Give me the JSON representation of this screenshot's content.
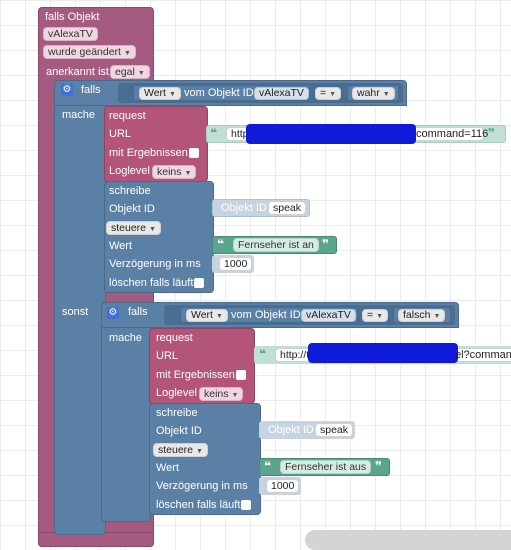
{
  "event_block": {
    "title": "falls Objekt",
    "object_id": "vAlexaTV",
    "trigger": "wurde geändert",
    "ack_label": "anerkannt ist",
    "ack_value": "egal"
  },
  "if_block_1": {
    "label": "falls",
    "do_label": "mache",
    "else_label": "sonst",
    "cond_value_select": "Wert",
    "cond_from_label": "vom Objekt ID",
    "cond_object_id": "vAlexaTV",
    "cond_operator": "=",
    "cond_compare": "wahr"
  },
  "request_1": {
    "title": "request",
    "url_label": "URL",
    "url_value_start": "http",
    "url_value_end": "command=116",
    "results_label": "mit Ergebnissen",
    "loglevel_label": "Loglevel",
    "loglevel_value": "keins"
  },
  "write_1": {
    "title": "schreibe",
    "object_label": "Objekt ID",
    "object_inline_label": "Objekt ID",
    "object_value": "speak",
    "mode": "steuere",
    "value_label": "Wert",
    "value_text": "Fernseher ist an",
    "delay_label": "Verzögerung in ms",
    "delay_value": "1000",
    "clear_label": "löschen falls läuft"
  },
  "if_block_2": {
    "label": "falls",
    "do_label": "mache",
    "cond_value_select": "Wert",
    "cond_from_label": "vom Objekt ID",
    "cond_object_id": "vAlexaTV",
    "cond_operator": "=",
    "cond_compare": "falsch"
  },
  "request_2": {
    "title": "request",
    "url_label": "URL",
    "url_value_start": "http://t",
    "url_value_end": "el?command",
    "results_label": "mit Ergebnissen",
    "loglevel_label": "Loglevel",
    "loglevel_value": "keins"
  },
  "write_2": {
    "title": "schreibe",
    "object_label": "Objekt ID",
    "object_inline_label": "Objekt ID",
    "object_value": "speak",
    "mode": "steuere",
    "value_label": "Wert",
    "value_text": "Fernseher ist aus",
    "delay_label": "Verzögerung in ms",
    "delay_value": "1000",
    "clear_label": "löschen falls läuft"
  },
  "colors": {
    "event_block": "#a55b80",
    "request_block": "#b3557a",
    "logic_block": "#5b80a5",
    "text_block": "#5ba58c",
    "redaction": "#0f1bd9"
  },
  "icons": {
    "gear": "gear-icon",
    "dropdown": "dropdown-caret-icon",
    "quote": "quote-icon"
  }
}
